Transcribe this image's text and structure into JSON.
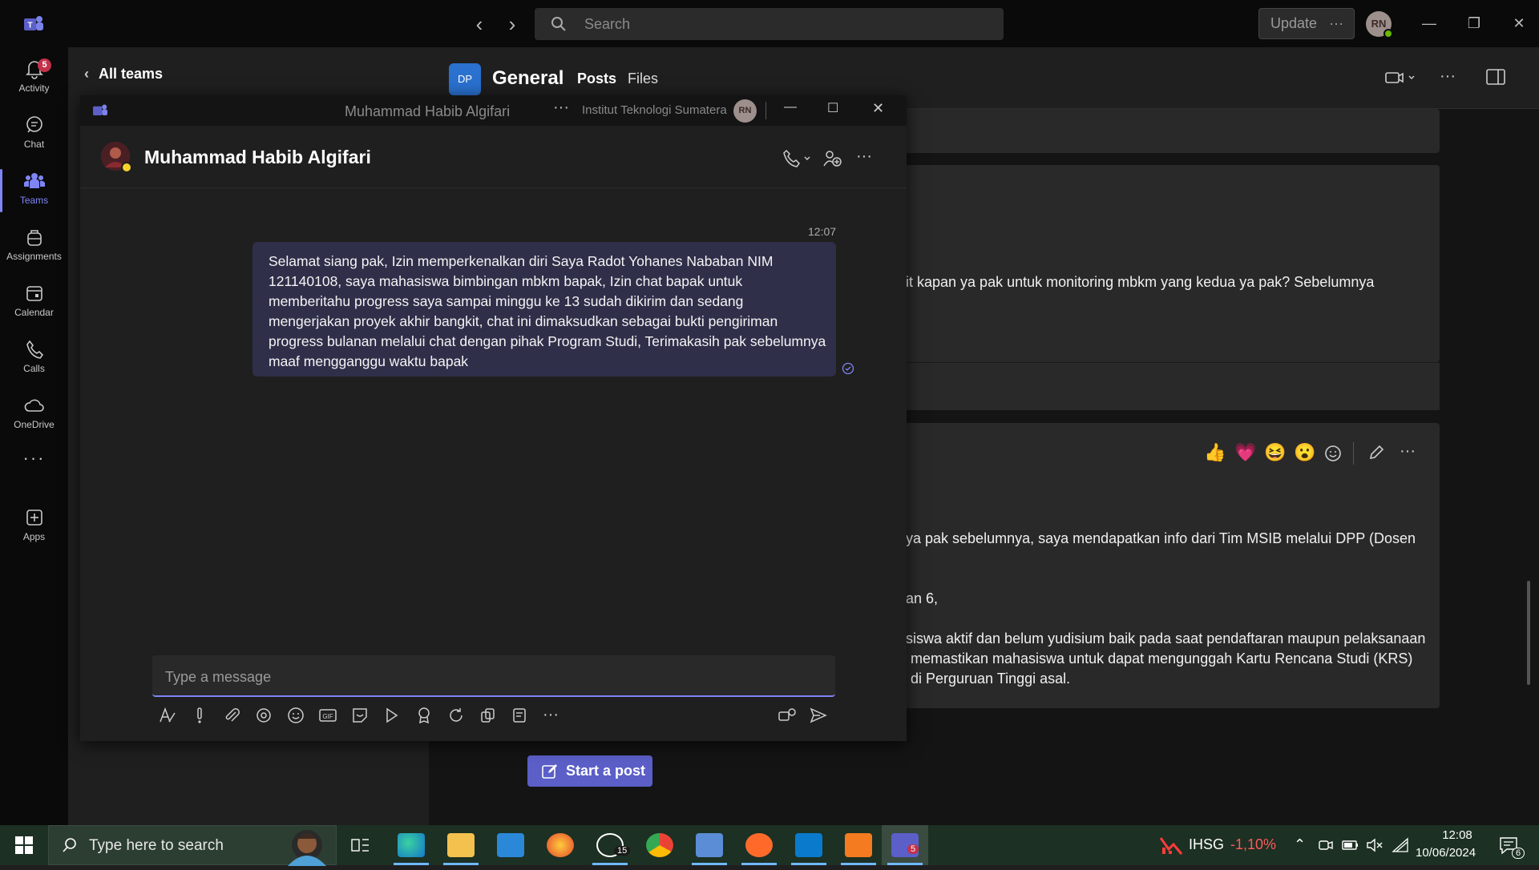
{
  "titlebar": {
    "search_placeholder": "Search",
    "update_label": "Update",
    "update_more": "···",
    "user_initials": "RN"
  },
  "rail": {
    "items": [
      {
        "label": "Activity",
        "badge": "5"
      },
      {
        "label": "Chat"
      },
      {
        "label": "Teams"
      },
      {
        "label": "Assignments"
      },
      {
        "label": "Calendar"
      },
      {
        "label": "Calls"
      },
      {
        "label": "OneDrive"
      },
      {
        "label": "Apps"
      }
    ],
    "more": "···"
  },
  "teams_panel": {
    "back_label": "All teams"
  },
  "channel": {
    "team_initials": "DP",
    "name": "General",
    "tabs": [
      "Posts",
      "Files"
    ],
    "post1_text": "it kapan ya pak untuk monitoring mbkm yang kedua ya pak? Sebelumnya",
    "post2_lines": [
      "ya pak sebelumnya, saya mendapatkan info dari Tim MSIB melalui DPP (Dosen",
      "an 6,",
      "siswa aktif dan belum yudisium baik pada saat pendaftaran maupun pelaksanaan",
      "memastikan mahasiswa untuk dapat mengunggah Kartu Rencana Studi (KRS)",
      "di Perguruan Tinggi asal."
    ],
    "reactions": [
      "👍",
      "💗",
      "😆",
      "😮"
    ],
    "start_post_label": "Start a post"
  },
  "popup": {
    "window_title": "Muhammad Habib Algifari",
    "org": "Institut Teknologi Sumatera",
    "org_initials": "RN",
    "contact_name": "Muhammad Habib Algifari",
    "message_time": "12:07",
    "message_lines": [
      "Selamat siang pak, Izin memperkenalkan diri Saya Radot Yohanes Nababan NIM",
      "121140108, saya mahasiswa bimbingan mbkm bapak, Izin chat bapak untuk",
      "memberitahu progress saya sampai minggu ke 13 sudah dikirim dan sedang",
      "mengerjakan proyek akhir bangkit, chat ini dimaksudkan sebagai bukti pengiriman",
      "progress bulanan melalui chat dengan pihak Program Studi, Terimakasih pak sebelumnya",
      "maaf mengganggu waktu bapak"
    ],
    "compose_placeholder": "Type a message"
  },
  "taskbar": {
    "search_placeholder": "Type here to search",
    "whatsapp_badge": "15",
    "teams_badge": "5",
    "ihsg_label": "IHSG",
    "ihsg_change": "-1,10%",
    "time": "12:08",
    "date": "10/06/2024",
    "notif_count": "6"
  },
  "colors": {
    "accent": "#7f85f5",
    "bubble": "#2f2f4a",
    "taskbar": "#1c3023",
    "negative": "#ff5a5a"
  }
}
